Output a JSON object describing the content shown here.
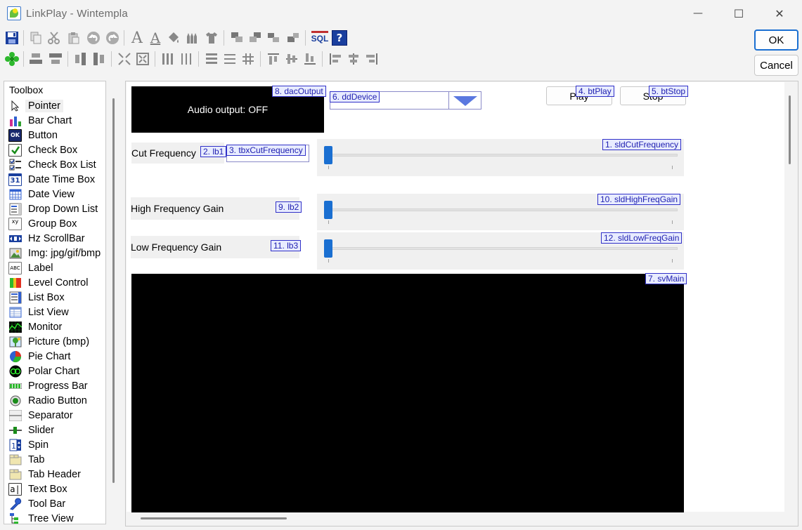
{
  "window": {
    "title": "LinkPlay   -   Wintempla",
    "minimize": "—",
    "maximize": "☐",
    "close": "✕"
  },
  "dialog": {
    "ok_label": "OK",
    "cancel_label": "Cancel"
  },
  "toolbar": {
    "sql_label": "SQL",
    "help_label": "?"
  },
  "toolbox": {
    "title": "Toolbox",
    "items": [
      {
        "label": "Pointer"
      },
      {
        "label": "Bar Chart"
      },
      {
        "label": "Button"
      },
      {
        "label": "Check Box"
      },
      {
        "label": "Check Box List"
      },
      {
        "label": "Date Time Box"
      },
      {
        "label": "Date View"
      },
      {
        "label": "Drop Down List"
      },
      {
        "label": "Group Box"
      },
      {
        "label": "Hz ScrollBar"
      },
      {
        "label": "Img: jpg/gif/bmp"
      },
      {
        "label": "Label"
      },
      {
        "label": "Level Control"
      },
      {
        "label": "List Box"
      },
      {
        "label": "List View"
      },
      {
        "label": "Monitor"
      },
      {
        "label": "Picture (bmp)"
      },
      {
        "label": "Pie Chart"
      },
      {
        "label": "Polar Chart"
      },
      {
        "label": "Progress Bar"
      },
      {
        "label": "Radio Button"
      },
      {
        "label": "Separator"
      },
      {
        "label": "Slider"
      },
      {
        "label": "Spin"
      },
      {
        "label": "Tab"
      },
      {
        "label": "Tab Header"
      },
      {
        "label": "Text Box"
      },
      {
        "label": "Tool Bar"
      },
      {
        "label": "Tree View"
      }
    ]
  },
  "design": {
    "dac": {
      "text": "Audio output: OFF",
      "tag": "8. dacOutput"
    },
    "dd": {
      "tag": "6. ddDevice"
    },
    "play": {
      "label": "Play",
      "tag": "4. btPlay"
    },
    "stop": {
      "label": "Stop",
      "tag": "5. btStop"
    },
    "lb1": {
      "text": "Cut Frequency",
      "tag": "2. lb1"
    },
    "tbx": {
      "tag": "3. tbxCutFrequency"
    },
    "sld_cut": {
      "tag": "1. sldCutFrequency"
    },
    "lb2": {
      "text": "High Frequency Gain",
      "tag": "9. lb2"
    },
    "sld_high": {
      "tag": "10. sldHighFreqGain"
    },
    "lb3": {
      "text": "Low Frequency Gain",
      "tag": "11. lb3"
    },
    "sld_low": {
      "tag": "12. sldLowFreqGain"
    },
    "sv": {
      "tag": "7. svMain"
    }
  },
  "colors": {
    "accent": "#1a6fd1",
    "tag_border": "#3030c8",
    "tag_bg": "#e8ecff"
  }
}
